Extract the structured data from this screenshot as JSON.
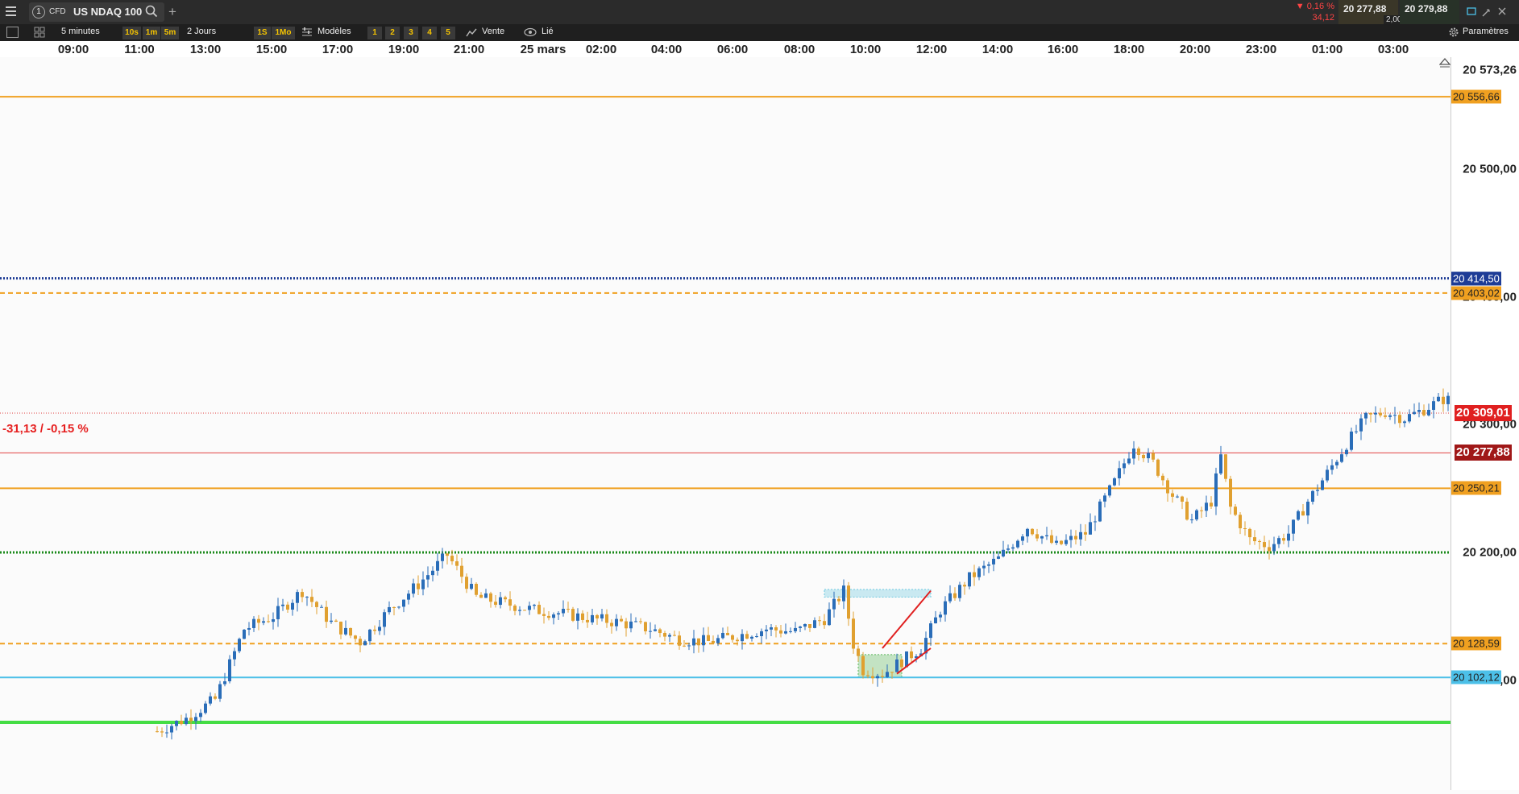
{
  "toolbar": {
    "menu_icon": "hamburger-menu-icon",
    "tab_number": "1",
    "instrument_type": "CFD",
    "instrument_name": "US NDAQ 100",
    "change_pct": "▼ 0,16 %",
    "change_abs": "34,12",
    "bid": "20 277,88",
    "ask": "20 279,88",
    "spread": "2,00",
    "add_tab": "+"
  },
  "subbar": {
    "timeframe": "5 minutes",
    "quick_timeframes": [
      "10s",
      "1m",
      "5m"
    ],
    "period": "2 Jours",
    "quick_periods": [
      "1S",
      "1Mo"
    ],
    "templates": "Modèles",
    "slots": [
      "1",
      "2",
      "3",
      "4",
      "5"
    ],
    "sell": "Vente",
    "linked": "Lié",
    "settings": "Paramètres"
  },
  "time_axis": [
    "09:00",
    "11:00",
    "13:00",
    "15:00",
    "17:00",
    "19:00",
    "21:00",
    "25 mars",
    "02:00",
    "04:00",
    "06:00",
    "08:00",
    "10:00",
    "12:00",
    "14:00",
    "16:00",
    "18:00",
    "20:00",
    "23:00",
    "01:00",
    "03:00"
  ],
  "chart_data": {
    "type": "candlestick",
    "title": "US NDAQ 100",
    "timeframe": "5 minutes",
    "x_ticks": [
      "09:00",
      "11:00",
      "13:00",
      "15:00",
      "17:00",
      "19:00",
      "21:00",
      "25 mars",
      "02:00",
      "04:00",
      "06:00",
      "08:00",
      "10:00",
      "12:00",
      "14:00",
      "16:00",
      "18:00",
      "20:00",
      "23:00",
      "01:00",
      "03:00"
    ],
    "y_ticks": [
      20500,
      20400,
      20300,
      20200,
      20100
    ],
    "ylim": [
      20060,
      20590
    ],
    "top_price_label": "20 573,26",
    "current_price": 20277.88,
    "current_price_label": "20 277,88",
    "reference_price": 20309.01,
    "reference_price_label": "20 309,01",
    "change_annotation": "-31,13 / -0,15 %",
    "horizontal_levels": [
      {
        "price": 20556.66,
        "label": "20 556,66",
        "color": "#f0a020",
        "style": "solid"
      },
      {
        "price": 20414.5,
        "label": "20 414,50",
        "color": "#1e3c96",
        "style": "dotted"
      },
      {
        "price": 20403.02,
        "label": "20 403,02",
        "color": "#f0a020",
        "style": "dashed"
      },
      {
        "price": 20250.21,
        "label": "20 250,21",
        "color": "#f0a020",
        "style": "solid"
      },
      {
        "price": 20200.0,
        "label": "",
        "color": "#1a8a1a",
        "style": "dotted"
      },
      {
        "price": 20128.59,
        "label": "20 128,59",
        "color": "#f0a020",
        "style": "dashed"
      },
      {
        "price": 20102.12,
        "label": "20 102,12",
        "color": "#4cc0e8",
        "style": "solid"
      },
      {
        "price": 20067.0,
        "label": "",
        "color": "#44dd44",
        "style": "solid"
      }
    ],
    "price_path": [
      [
        0,
        20060
      ],
      [
        6,
        20070
      ],
      [
        12,
        20085
      ],
      [
        18,
        20140
      ],
      [
        24,
        20150
      ],
      [
        30,
        20170
      ],
      [
        36,
        20145
      ],
      [
        42,
        20130
      ],
      [
        48,
        20155
      ],
      [
        54,
        20175
      ],
      [
        60,
        20198
      ],
      [
        66,
        20165
      ],
      [
        72,
        20160
      ],
      [
        78,
        20155
      ],
      [
        84,
        20152
      ],
      [
        90,
        20148
      ],
      [
        96,
        20145
      ],
      [
        102,
        20140
      ],
      [
        108,
        20132
      ],
      [
        114,
        20130
      ],
      [
        120,
        20135
      ],
      [
        126,
        20140
      ],
      [
        132,
        20138
      ],
      [
        138,
        20148
      ],
      [
        142,
        20170
      ],
      [
        144,
        20128
      ],
      [
        146,
        20108
      ],
      [
        150,
        20105
      ],
      [
        154,
        20115
      ],
      [
        158,
        20125
      ],
      [
        162,
        20155
      ],
      [
        168,
        20180
      ],
      [
        174,
        20195
      ],
      [
        180,
        20220
      ],
      [
        186,
        20205
      ],
      [
        192,
        20215
      ],
      [
        198,
        20255
      ],
      [
        202,
        20285
      ],
      [
        206,
        20270
      ],
      [
        210,
        20245
      ],
      [
        214,
        20225
      ],
      [
        218,
        20240
      ],
      [
        220,
        20275
      ],
      [
        222,
        20235
      ],
      [
        226,
        20210
      ],
      [
        230,
        20205
      ],
      [
        234,
        20215
      ],
      [
        238,
        20240
      ],
      [
        242,
        20262
      ],
      [
        246,
        20285
      ],
      [
        250,
        20305
      ],
      [
        254,
        20310
      ],
      [
        258,
        20305
      ],
      [
        262,
        20312
      ],
      [
        266,
        20320
      ],
      [
        270,
        20317
      ],
      [
        274,
        20310
      ],
      [
        278,
        20305
      ],
      [
        282,
        20290
      ],
      [
        284,
        20278
      ],
      [
        288,
        20290
      ],
      [
        292,
        20280
      ],
      [
        296,
        20277.88
      ]
    ],
    "drawn_channel": {
      "color": "#e02020",
      "lines": [
        [
          [
            150,
            20125
          ],
          [
            160,
            20170
          ]
        ],
        [
          [
            153,
            20105
          ],
          [
            160,
            20125
          ]
        ]
      ]
    },
    "shaded_zones": [
      {
        "from": [
          138,
          20171
        ],
        "to": [
          160,
          20165
        ],
        "color": "#6ec8e0"
      },
      {
        "from": [
          145,
          20120
        ],
        "to": [
          154,
          20102
        ],
        "color": "#5cb85c"
      }
    ]
  }
}
